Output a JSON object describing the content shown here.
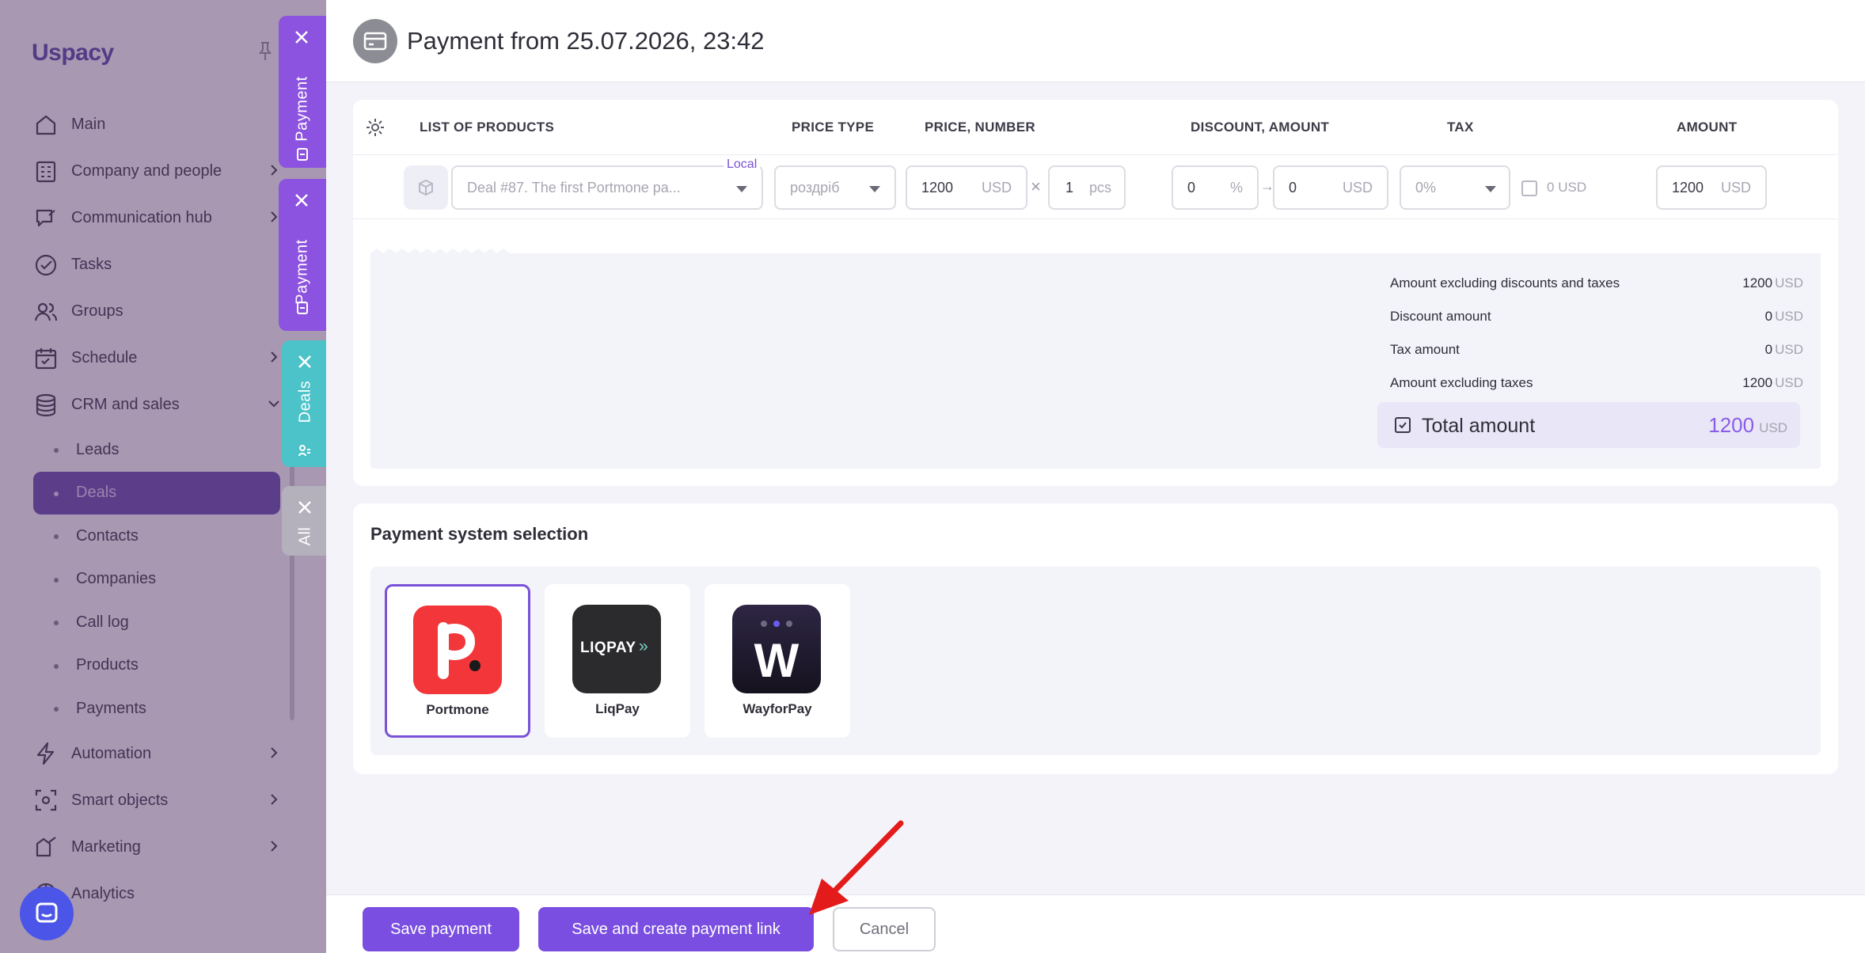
{
  "sidebar": {
    "logo": "Uspacy",
    "items": [
      {
        "label": "Main",
        "icon": "home-icon",
        "chevron": false
      },
      {
        "label": "Company and people",
        "icon": "company-icon",
        "chevron": true
      },
      {
        "label": "Communication hub",
        "icon": "chat-icon",
        "chevron": true
      },
      {
        "label": "Tasks",
        "icon": "check-circle-icon",
        "chevron": false
      },
      {
        "label": "Groups",
        "icon": "groups-icon",
        "chevron": false
      },
      {
        "label": "Schedule",
        "icon": "calendar-icon",
        "chevron": true
      },
      {
        "label": "CRM and sales",
        "icon": "database-icon",
        "chevron": "down"
      }
    ],
    "crm_sub": [
      "Leads",
      "Deals",
      "Contacts",
      "Companies",
      "Call log",
      "Products",
      "Payments"
    ],
    "crm_active": "Deals",
    "bottom_items": [
      {
        "label": "Automation",
        "icon": "lightning-icon"
      },
      {
        "label": "Smart objects",
        "icon": "smart-object-icon"
      },
      {
        "label": "Marketing",
        "icon": "marketing-icon"
      },
      {
        "label": "Analytics",
        "icon": "analytics-icon"
      }
    ]
  },
  "side_tabs": [
    {
      "label": "Payment",
      "color": "#8c52e0"
    },
    {
      "label": "Payment",
      "color": "#8c52e0"
    },
    {
      "label": "Deals",
      "color": "#4cc3c9"
    },
    {
      "label": "All",
      "color": "#b4b0bc"
    }
  ],
  "header": {
    "title": "Payment from 25.07.2026, 23:42"
  },
  "products": {
    "columns": [
      "LIST OF PRODUCTS",
      "PRICE TYPE",
      "PRICE, NUMBER",
      "DISCOUNT, AMOUNT",
      "TAX",
      "AMOUNT"
    ],
    "row": {
      "product": "Deal #87. The first Portmone pa...",
      "badge": "Local",
      "price_type": "роздріб",
      "price": "1200",
      "price_currency": "USD",
      "times": "×",
      "quantity": "1",
      "quantity_unit": "pcs",
      "discount_percent": "0",
      "percent_sign": "%",
      "arrow": "→",
      "discount_amount": "0",
      "discount_currency": "USD",
      "tax": "0%",
      "tax_amount": "0",
      "tax_currency": "USD",
      "amount": "1200",
      "amount_currency": "USD"
    }
  },
  "summary": {
    "rows": [
      {
        "label": "Amount excluding discounts and taxes",
        "value": "1200",
        "currency": "USD"
      },
      {
        "label": "Discount amount",
        "value": "0",
        "currency": "USD"
      },
      {
        "label": "Tax amount",
        "value": "0",
        "currency": "USD"
      },
      {
        "label": "Amount excluding taxes",
        "value": "1200",
        "currency": "USD"
      }
    ],
    "total_label": "Total amount",
    "total_value": "1200",
    "total_currency": "USD"
  },
  "payment_systems": {
    "title": "Payment system selection",
    "options": [
      {
        "name": "Portmone",
        "selected": true
      },
      {
        "name": "LiqPay",
        "logo_text": "LIQPAY",
        "selected": false
      },
      {
        "name": "WayforPay",
        "logo_text": "W",
        "selected": false
      }
    ]
  },
  "footer": {
    "save": "Save payment",
    "save_link": "Save and create payment link",
    "cancel": "Cancel"
  },
  "colors": {
    "accent": "#7a4ee0",
    "total": "#8a5ce6",
    "portmone": "#f2363a",
    "liqpay": "#2b2b2e",
    "wayforpay": "#1e1a2b"
  }
}
